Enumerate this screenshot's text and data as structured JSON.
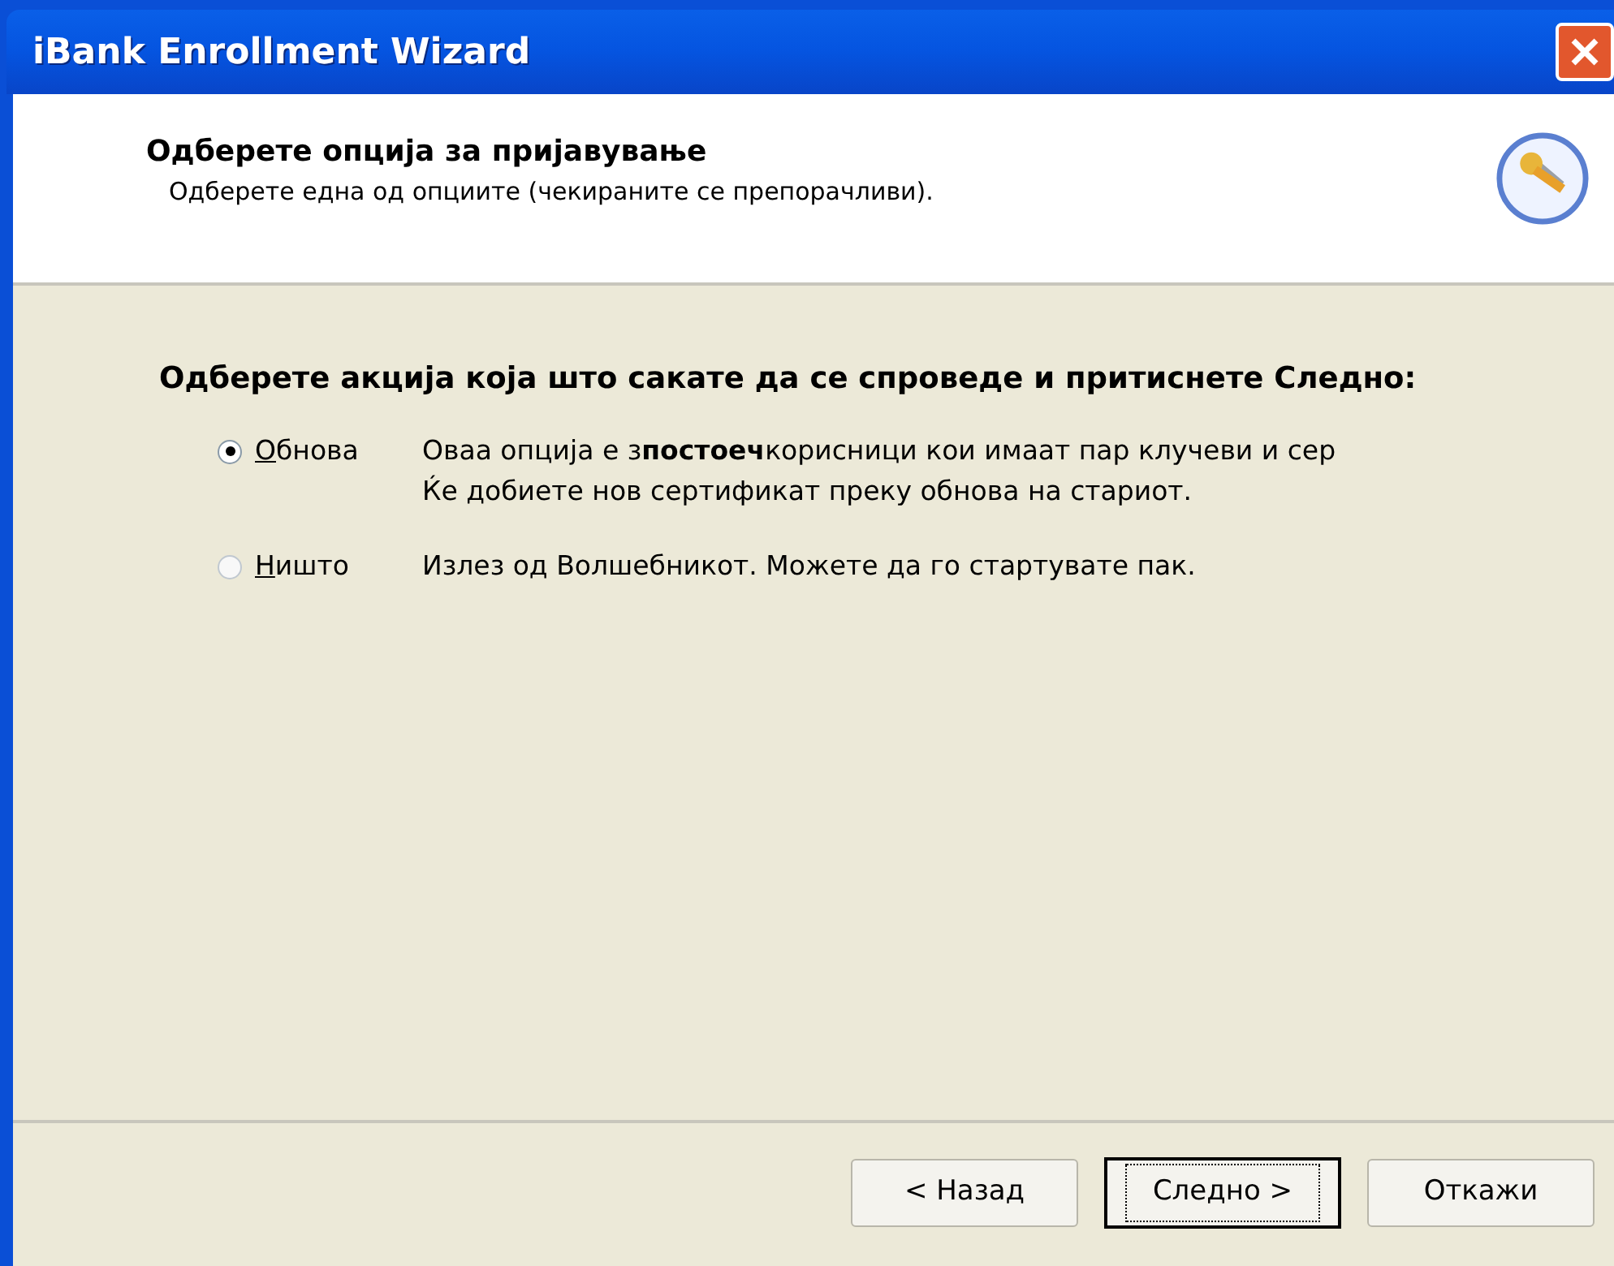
{
  "window": {
    "title": "iBank Enrollment Wizard"
  },
  "header": {
    "title": "Одберете опција за пријавување",
    "subtitle": "Одберете една од опциите (чекираните се препорачливи)."
  },
  "prompt": "Одберете акција која што сакате да се спроведе и притиснете Следно:",
  "options": [
    {
      "label": "Обнова",
      "selected": true,
      "lines": [
        "Оваа опција е з**постоеч**корисници кои имаат пар клучеви и сер",
        "Ќе добиете нов сертификат преку обнова на стариот."
      ]
    },
    {
      "label": "Ништо",
      "selected": false,
      "lines": [
        "Излез од Волшебникот. Можете да го стартувате пак."
      ]
    }
  ],
  "buttons": [
    {
      "label": "< Назад",
      "focused": false
    },
    {
      "label": "Следно >",
      "focused": true
    },
    {
      "label": "Откажи",
      "focused": false
    }
  ]
}
